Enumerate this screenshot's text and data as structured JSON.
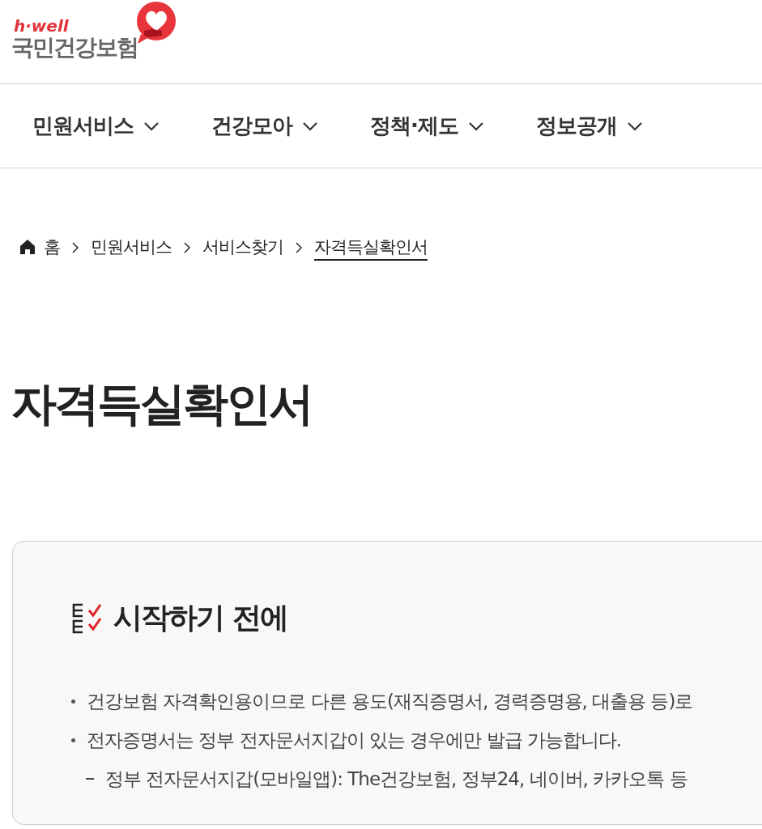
{
  "header": {
    "logo_tagline": "h·well",
    "logo_name": "국민건강보험"
  },
  "nav": [
    {
      "label": "민원서비스"
    },
    {
      "label": "건강모아"
    },
    {
      "label": "정책·제도"
    },
    {
      "label": "정보공개"
    }
  ],
  "breadcrumb": [
    {
      "label": "홈",
      "kind": "home"
    },
    {
      "label": "민원서비스",
      "kind": "link"
    },
    {
      "label": "서비스찾기",
      "kind": "link"
    },
    {
      "label": "자격득실확인서",
      "kind": "current"
    }
  ],
  "page_title": "자격득실확인서",
  "notice": {
    "title": "시작하기 전에",
    "items": [
      {
        "text": "건강보험 자격확인용이므로 다른 용도(재직증명서, 경력증명용, 대출용 등)로",
        "kind": "bullet"
      },
      {
        "text": "전자증명서는 정부 전자문서지갑이 있는 경우에만 발급 가능합니다.",
        "kind": "bullet"
      },
      {
        "text": "정부 전자문서지갑(모바일앱): The건강보험, 정부24, 네이버, 카카오톡 등",
        "kind": "dash"
      }
    ]
  }
}
